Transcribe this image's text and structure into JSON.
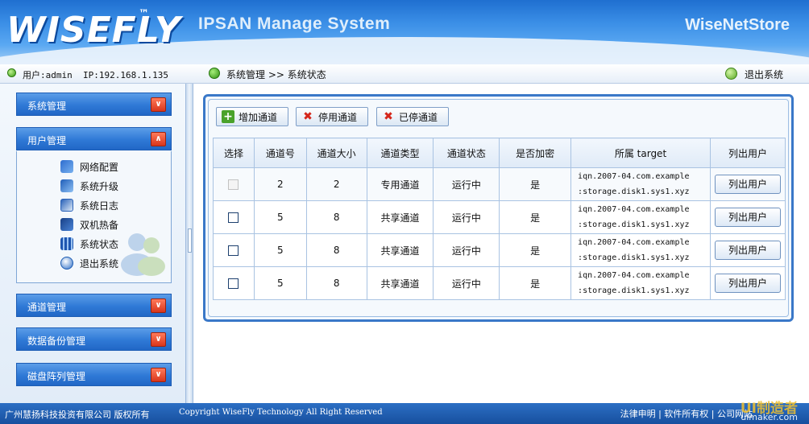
{
  "header": {
    "logo": "WISEFLY",
    "trademark": "™",
    "system_title": "IPSAN Manage System",
    "brand": "WiseNetStore"
  },
  "infobar": {
    "user_info": "用户:admin  IP:192.168.1.135",
    "breadcrumb": "系统管理 >> 系统状态",
    "logout": "退出系统"
  },
  "sidebar": {
    "menus": [
      {
        "label": "系统管理",
        "state": "collapsed"
      },
      {
        "label": "用户管理",
        "state": "expanded"
      },
      {
        "label": "通道管理",
        "state": "collapsed"
      },
      {
        "label": "数据备份管理",
        "state": "collapsed"
      },
      {
        "label": "磁盘阵列管理",
        "state": "collapsed"
      }
    ],
    "sub_items": [
      {
        "label": "网络配置",
        "icon": "network-icon"
      },
      {
        "label": "系统升级",
        "icon": "upgrade-icon"
      },
      {
        "label": "系统日志",
        "icon": "log-icon"
      },
      {
        "label": "双机热备",
        "icon": "hot-standby-icon"
      },
      {
        "label": "系统状态",
        "icon": "status-icon"
      },
      {
        "label": "退出系统",
        "icon": "exit-icon"
      }
    ]
  },
  "toolbar": {
    "add": "增加通道",
    "disable": "停用通道",
    "disabled": "已停通道"
  },
  "table": {
    "headers": [
      "选择",
      "通道号",
      "通道大小",
      "通道类型",
      "通道状态",
      "是否加密",
      "所属 target",
      "列出用户"
    ],
    "rows": [
      {
        "checkbox_disabled": true,
        "channel": "2",
        "size": "2",
        "type": "专用通道",
        "status": "运行中",
        "encrypted": "是",
        "target_line1": "iqn.2007-04.com.example",
        "target_line2": ":storage.disk1.sys1.xyz",
        "action": "列出用户"
      },
      {
        "checkbox_disabled": false,
        "channel": "5",
        "size": "8",
        "type": "共享通道",
        "status": "运行中",
        "encrypted": "是",
        "target_line1": "iqn.2007-04.com.example",
        "target_line2": ":storage.disk1.sys1.xyz",
        "action": "列出用户"
      },
      {
        "checkbox_disabled": false,
        "channel": "5",
        "size": "8",
        "type": "共享通道",
        "status": "运行中",
        "encrypted": "是",
        "target_line1": "iqn.2007-04.com.example",
        "target_line2": ":storage.disk1.sys1.xyz",
        "action": "列出用户"
      },
      {
        "checkbox_disabled": false,
        "channel": "5",
        "size": "8",
        "type": "共享通道",
        "status": "运行中",
        "encrypted": "是",
        "target_line1": "iqn.2007-04.com.example",
        "target_line2": ":storage.disk1.sys1.xyz",
        "action": "列出用户"
      }
    ]
  },
  "footer": {
    "company": "广州慧扬科技投资有限公司 版权所有",
    "copyright": "Copyright WiseFly Technology All Right Reserved",
    "links": "法律申明 | 软件所有权 | 公司网站",
    "watermark": "UI制造者",
    "watermark_url": "uimaker.com"
  },
  "colors": {
    "header_blue": "#2f79d6",
    "menu_toggle_red": "#d8361c",
    "grid_border": "#a9c3e2"
  }
}
